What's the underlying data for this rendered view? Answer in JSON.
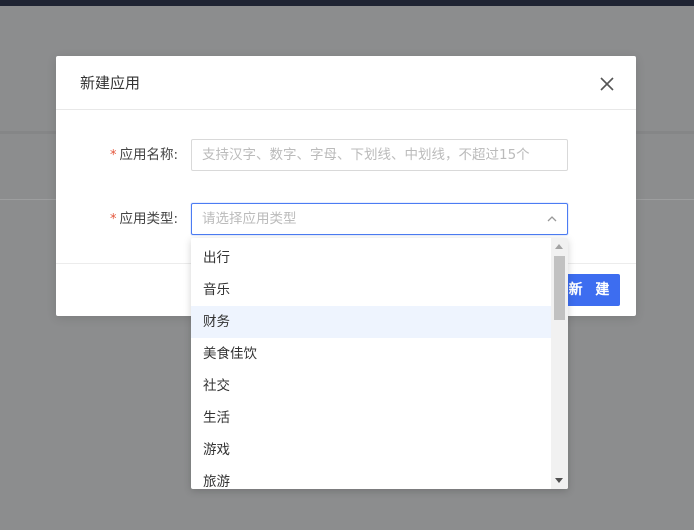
{
  "modal": {
    "title": "新建应用",
    "close_icon": "close-icon",
    "fields": {
      "name": {
        "required_mark": "*",
        "label": "应用名称:",
        "placeholder": "支持汉字、数字、字母、下划线、中划线，不超过15个"
      },
      "type": {
        "required_mark": "*",
        "label": "应用类型:",
        "placeholder": "请选择应用类型"
      }
    },
    "create_button": "新 建"
  },
  "dropdown": {
    "options": [
      "出行",
      "音乐",
      "财务",
      "美食佳饮",
      "社交",
      "生活",
      "游戏",
      "旅游"
    ],
    "hovered_index": 2
  },
  "colors": {
    "primary": "#3d6df0",
    "required": "#e4553a",
    "hover_bg": "#eef4fe",
    "overlay": "#8c8d8e"
  }
}
